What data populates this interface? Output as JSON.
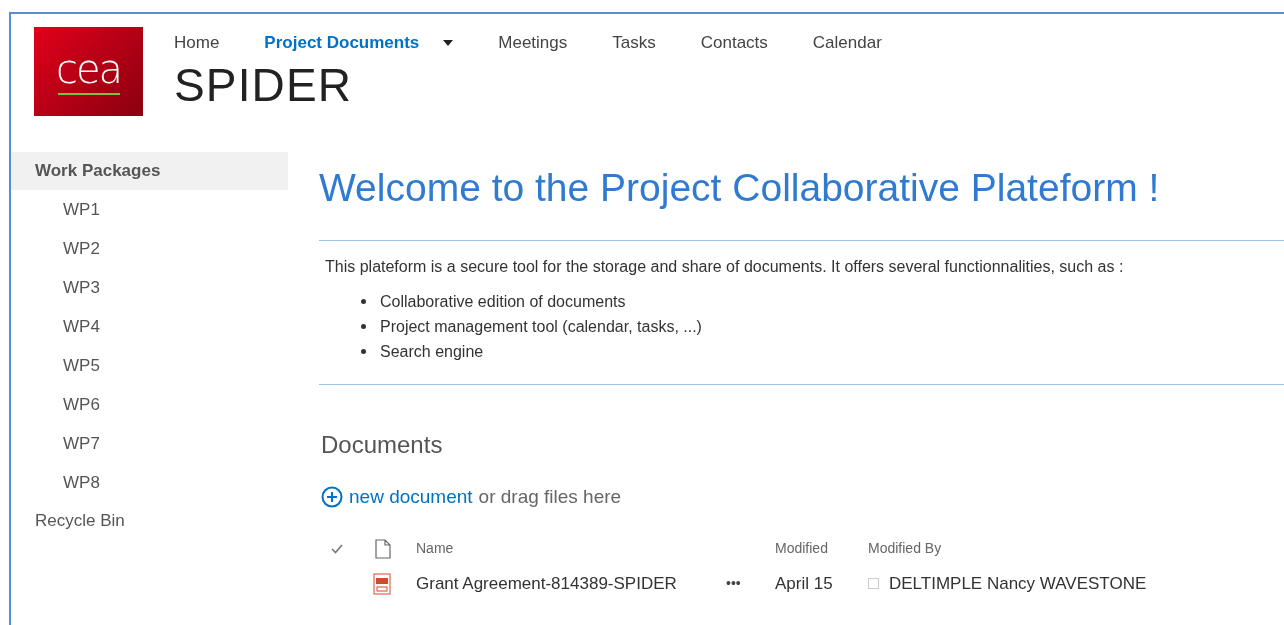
{
  "logo": {
    "text": "cea"
  },
  "top_nav": [
    {
      "label": "Home",
      "selected": false,
      "has_menu": false
    },
    {
      "label": "Project Documents",
      "selected": true,
      "has_menu": true
    },
    {
      "label": "Meetings",
      "selected": false,
      "has_menu": false
    },
    {
      "label": "Tasks",
      "selected": false,
      "has_menu": false
    },
    {
      "label": "Contacts",
      "selected": false,
      "has_menu": false
    },
    {
      "label": "Calendar",
      "selected": false,
      "has_menu": false
    }
  ],
  "site_title": "SPIDER",
  "sidebar": {
    "items": [
      {
        "label": "Work Packages",
        "selected": true,
        "children": [
          {
            "label": "WP1",
            "selected": false
          },
          {
            "label": "WP2",
            "selected": false
          },
          {
            "label": "WP3",
            "selected": false
          },
          {
            "label": "WP4",
            "selected": false
          },
          {
            "label": "WP5",
            "selected": false
          },
          {
            "label": "WP6",
            "selected": false
          },
          {
            "label": "WP7",
            "selected": false
          },
          {
            "label": "WP8",
            "selected": false
          }
        ]
      },
      {
        "label": "Recycle Bin",
        "selected": false
      }
    ]
  },
  "welcome": {
    "heading": "Welcome to the Project Collaborative Plateform !",
    "intro": "This plateform is a secure tool for the storage and share of documents. It offers several functionnalities, such as :",
    "bullets": [
      "Collaborative edition of documents",
      "Project management tool (calendar, tasks, ...)",
      "Search engine"
    ]
  },
  "documents": {
    "heading": "Documents",
    "new_link": "new document",
    "drag_text": "or drag files here",
    "columns": [
      "Name",
      "Modified",
      "Modified By"
    ],
    "rows": [
      {
        "name": "Grant Agreement-814389-SPIDER",
        "menu": "•••",
        "modified": "April 15",
        "modified_by": "DELTIMPLE Nancy WAVESTONE"
      }
    ]
  }
}
